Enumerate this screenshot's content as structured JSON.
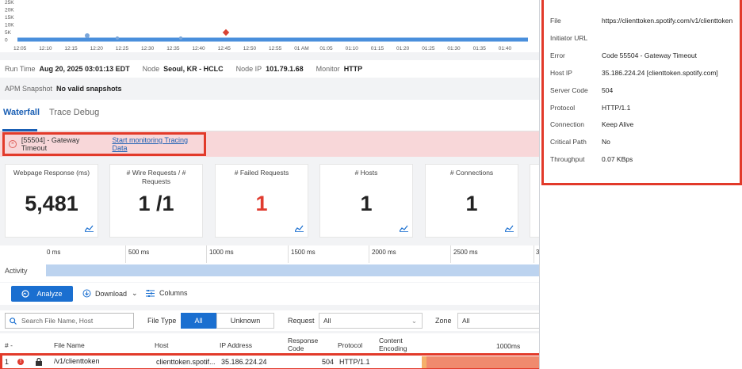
{
  "chart": {
    "y_ticks": [
      "25K",
      "20K",
      "15K",
      "10K",
      "5K",
      "0"
    ],
    "x_ticks": [
      "12:05",
      "12:10",
      "12:15",
      "12:20",
      "12:25",
      "12:30",
      "12:35",
      "12:40",
      "12:45",
      "12:50",
      "12:55",
      "01 AM",
      "01:05",
      "01:10",
      "01:15",
      "01:20",
      "01:25",
      "01:30",
      "01:35",
      "01:40"
    ],
    "series_color": "#4a8fdc",
    "error_marker_color": "#d94334"
  },
  "info_row": {
    "run_time_label": "Run Time",
    "run_time": "Aug 20, 2025 03:01:13 EDT",
    "node_label": "Node",
    "node": "Seoul, KR - HCLC",
    "node_ip_label": "Node IP",
    "node_ip": "101.79.1.68",
    "monitor_label": "Monitor",
    "monitor": "HTTP"
  },
  "apm_row": {
    "label": "APM Snapshot",
    "value": "No valid snapshots"
  },
  "tabs": [
    "Waterfall",
    "Trace Debug"
  ],
  "error_bar": {
    "message": "[55504] - Gateway Timeout",
    "link": "Start monitoring Tracing Data"
  },
  "cards": [
    {
      "title": "Webpage Response (ms)",
      "value": "5,481"
    },
    {
      "title": "# Wire Requests / # Requests",
      "value": "1 /1"
    },
    {
      "title": "# Failed Requests",
      "value": "1"
    },
    {
      "title": "# Hosts",
      "value": "1"
    },
    {
      "title": "# Connections",
      "value": "1"
    }
  ],
  "timeline": {
    "label": "Activity",
    "ticks": [
      "0 ms",
      "500 ms",
      "1000 ms",
      "1500 ms",
      "2000 ms",
      "2500 ms",
      "3"
    ]
  },
  "toolbar": {
    "analyze": "Analyze",
    "download": "Download",
    "columns": "Columns"
  },
  "filters": {
    "search_placeholder": "Search File Name, Host",
    "file_type_label": "File Type",
    "file_type_all": "All",
    "file_type_unknown": "Unknown",
    "request_label": "Request",
    "request_value": "All",
    "zone_label": "Zone",
    "zone_value": "All"
  },
  "table": {
    "headers": {
      "num": "# -",
      "file_name": "File Name",
      "host": "Host",
      "ip": "IP Address",
      "response_code": "Response Code",
      "protocol": "Protocol",
      "content_encoding": "Content Encoding",
      "wf_tick": "1000ms"
    },
    "rows": [
      {
        "num": "1",
        "file": "/v1/clienttoken",
        "host": "clienttoken.spotif...",
        "ip": "35.186.224.24",
        "code": "504",
        "protocol": "HTTP/1.1"
      }
    ]
  },
  "details": [
    {
      "label": "File",
      "value": "https://clienttoken.spotify.com/v1/clienttoken"
    },
    {
      "label": "Initiator URL",
      "value": ""
    },
    {
      "label": "Error",
      "value": "Code 55504 - Gateway Timeout"
    },
    {
      "label": "Host IP",
      "value": "35.186.224.24 [clienttoken.spotify.com]"
    },
    {
      "label": "Server Code",
      "value": "504"
    },
    {
      "label": "Protocol",
      "value": "HTTP/1.1"
    },
    {
      "label": "Connection",
      "value": "Keep Alive"
    },
    {
      "label": "Critical Path",
      "value": "No"
    },
    {
      "label": "Throughput",
      "value": "0.07 KBps"
    }
  ]
}
